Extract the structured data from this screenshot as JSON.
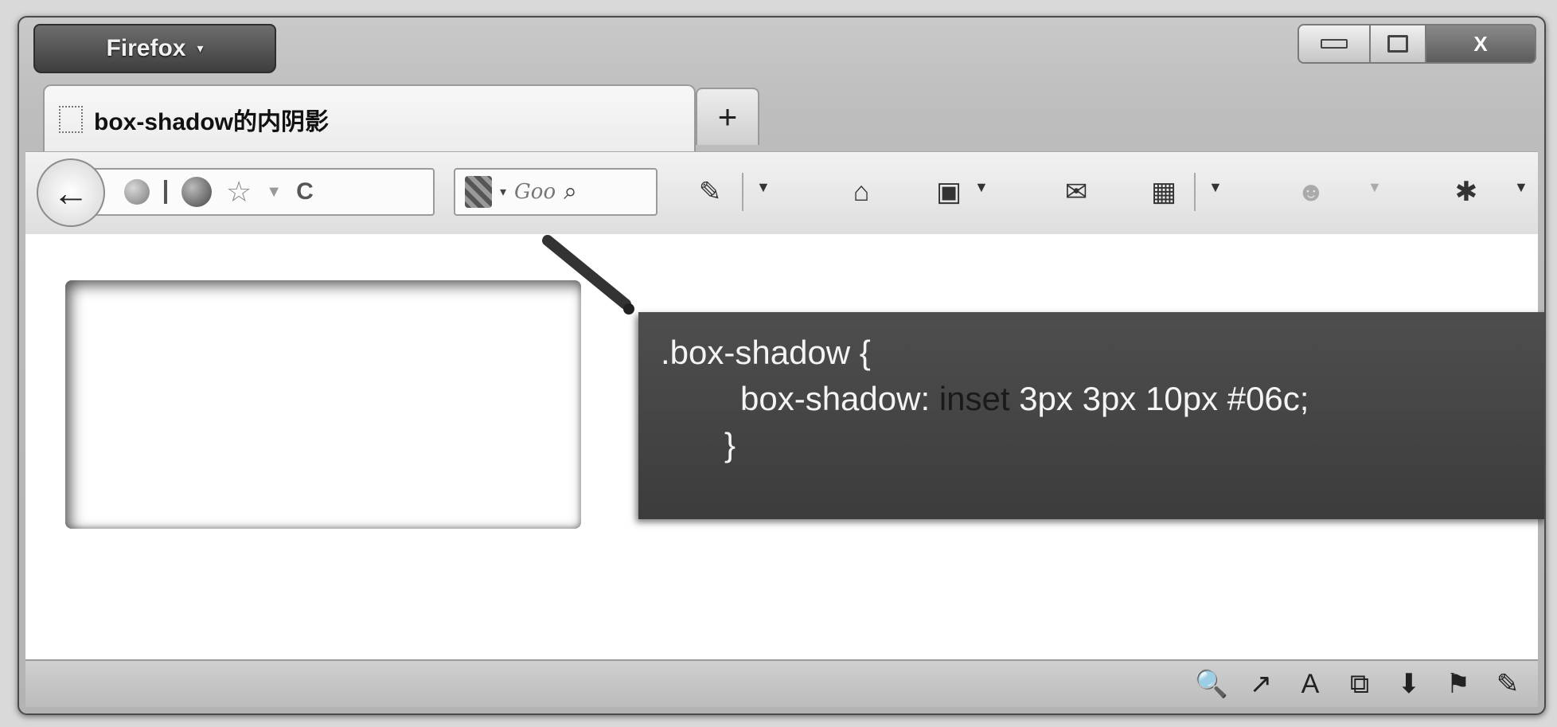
{
  "window": {
    "app_button": "Firefox",
    "app_button_caret": "▾",
    "controls": {
      "close": "X"
    }
  },
  "tabs": [
    {
      "label": "box-shadow的内阴影"
    }
  ],
  "new_tab_label": "+",
  "navbar": {
    "back_glyph": "←",
    "reload_glyph": "C",
    "search_placeholder": "Goo",
    "search_glyph": "⌕",
    "icons": [
      "pen-tool-icon",
      "home-icon",
      "bookmark-star-icon",
      "mail-icon",
      "apps-grid-icon",
      "user-icon",
      "bug-icon"
    ]
  },
  "code": {
    "line1": ".box-shadow {",
    "line2_prop": "box-shadow: ",
    "line2_kw": "inset",
    "line2_rest": " 3px 3px 10px #06c;",
    "line3": "}"
  },
  "statusbar": {
    "icons": [
      "🔍",
      "↗",
      "A",
      "⧉",
      "⬇",
      "⚑",
      "✎"
    ]
  }
}
